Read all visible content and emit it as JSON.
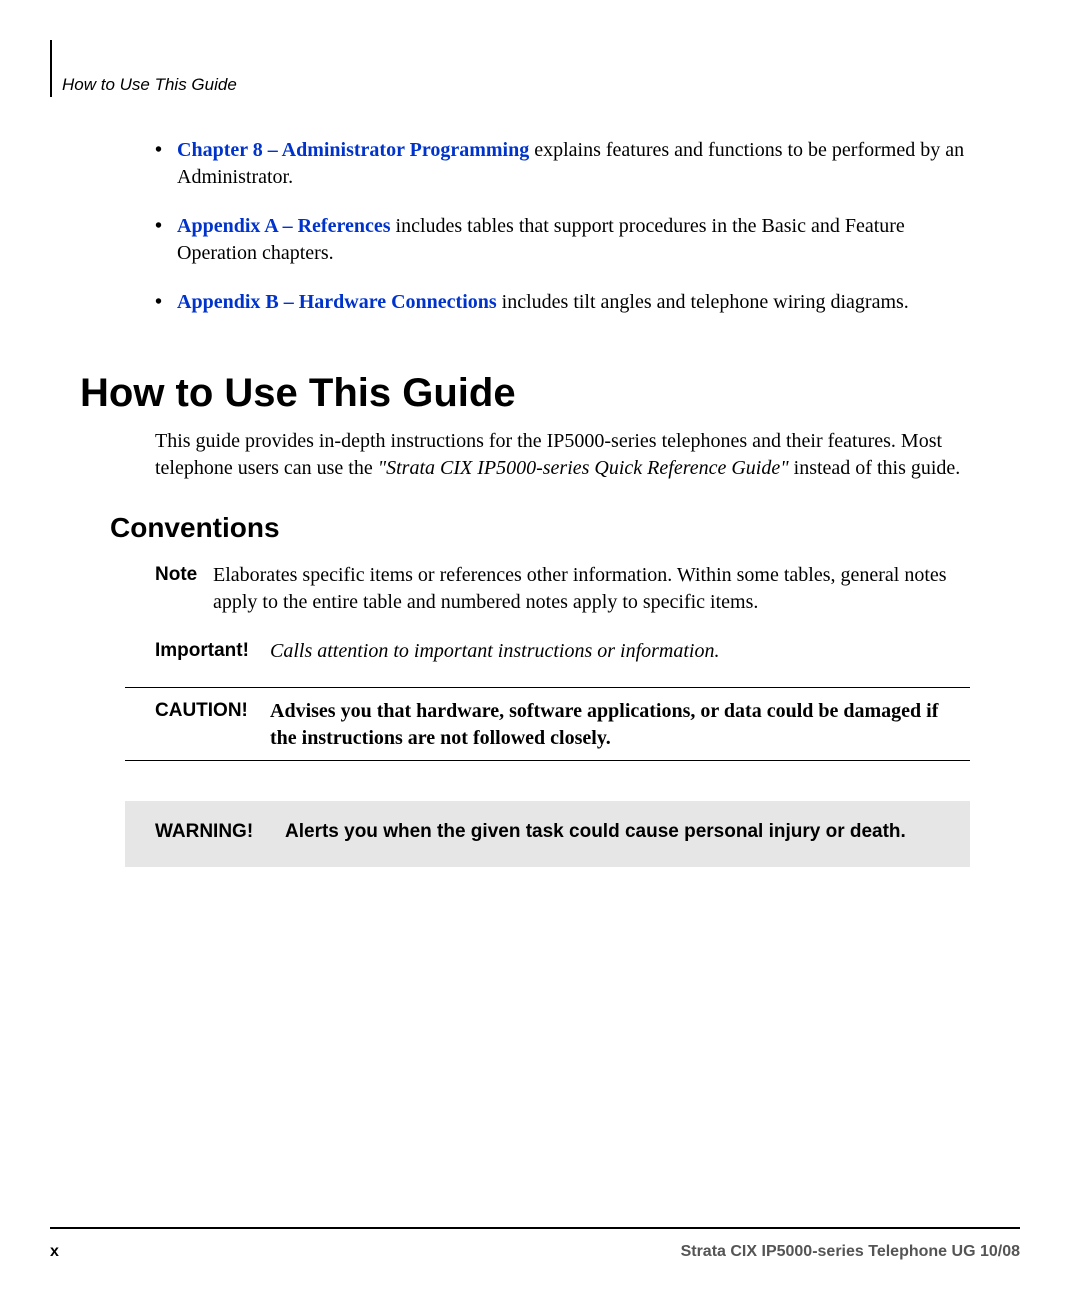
{
  "header": {
    "running_head": "How to Use This Guide"
  },
  "bullets": [
    {
      "link": "Chapter 8 – Administrator Programming",
      "rest": " explains features and functions to be performed by an Administrator."
    },
    {
      "link": "Appendix A – References",
      "rest": " includes tables that support procedures in the Basic and Feature Operation chapters."
    },
    {
      "link": "Appendix B – Hardware Connections",
      "rest": " includes tilt angles and telephone wiring diagrams."
    }
  ],
  "section_title": "How to Use This Guide",
  "intro": {
    "part1": "This guide provides in-depth instructions for the IP5000-series telephones and their features. Most telephone users can use the ",
    "italic": "\"Strata CIX IP5000-series Quick Reference Guide\"",
    "part2": " instead of this guide."
  },
  "sub_title": "Conventions",
  "conventions": {
    "note_label": "Note",
    "note_text": "Elaborates specific items or references other information. Within some tables, general notes apply to the entire table and numbered notes apply to specific items.",
    "important_label": "Important!",
    "important_text": "Calls attention to important instructions or information.",
    "caution_label": "CAUTION!",
    "caution_text": "Advises you that hardware, software applications, or data could be damaged if the instructions are not followed closely.",
    "warning_label": "WARNING!",
    "warning_text": "Alerts you when the given task could cause personal injury or death."
  },
  "footer": {
    "page": "x",
    "text": "Strata CIX IP5000-series Telephone UG    10/08"
  }
}
